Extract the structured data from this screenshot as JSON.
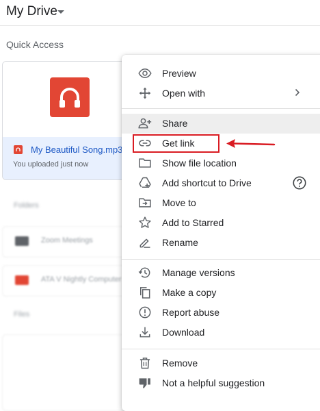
{
  "header": {
    "title": "My Drive"
  },
  "quick_access": {
    "label": "Quick Access",
    "file": {
      "name": "My Beautiful Song.mp3",
      "subtitle": "You uploaded just now"
    }
  },
  "background_blurred": {
    "folders_label": "Folders",
    "folder_1": "Zoom Meetings",
    "folder_2": "ATA V Nightly Computer",
    "files_label": "Files"
  },
  "context_menu": {
    "preview": "Preview",
    "open_with": "Open with",
    "share": "Share",
    "get_link": "Get link",
    "show_file_location": "Show file location",
    "add_shortcut": "Add shortcut to Drive",
    "move_to": "Move to",
    "add_to_starred": "Add to Starred",
    "rename": "Rename",
    "manage_versions": "Manage versions",
    "make_copy": "Make a copy",
    "report_abuse": "Report abuse",
    "download": "Download",
    "remove": "Remove",
    "not_helpful": "Not a helpful suggestion"
  },
  "colors": {
    "annotation": "#d91b22",
    "audio_icon": "#e24634",
    "file_link": "#1a56c4",
    "selected_card": "#e8f0fe",
    "hover_row": "#eeeeee"
  },
  "icons": {
    "preview": "eye-icon",
    "open_with": "move-arrows-icon",
    "share": "person-add-icon",
    "get_link": "link-icon",
    "show_file_location": "folder-icon",
    "add_shortcut": "drive-shortcut-icon",
    "move_to": "move-folder-icon",
    "add_to_starred": "star-icon",
    "rename": "pencil-icon",
    "manage_versions": "history-icon",
    "make_copy": "copy-icon",
    "report_abuse": "alert-icon",
    "download": "download-icon",
    "remove": "trash-icon",
    "not_helpful": "thumbs-down-icon"
  }
}
